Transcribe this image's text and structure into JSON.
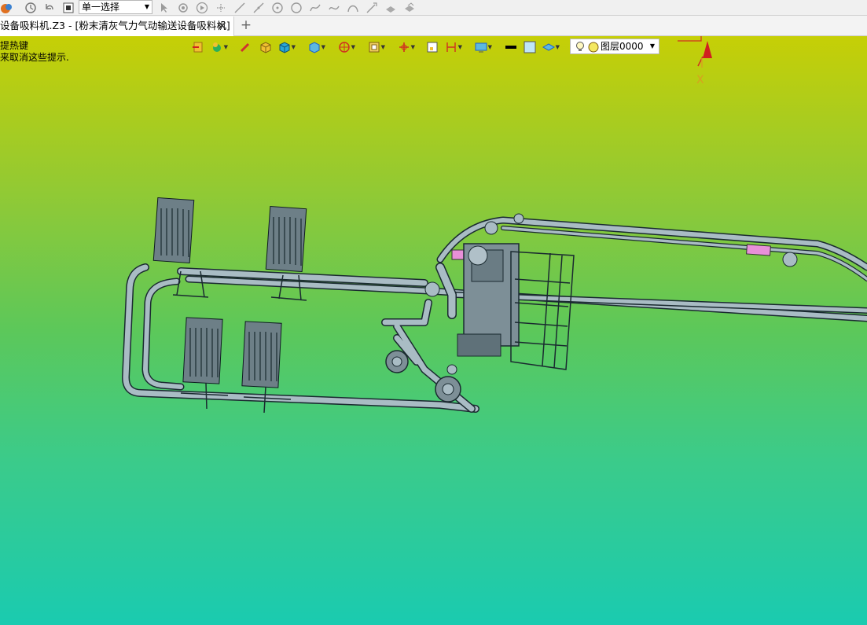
{
  "toolbar": {
    "filter_value": "单一选择",
    "icons": [
      "app-logo-icon",
      "history-icon",
      "undo-icon",
      "stop-icon",
      "cursor-icon",
      "snap-icon",
      "play-icon",
      "point-icon",
      "line-icon",
      "line-2-icon",
      "circle-icon",
      "circle-2-icon",
      "spline-icon",
      "curve-icon",
      "arc-icon",
      "extend-icon",
      "surface-icon",
      "surface-2-icon"
    ]
  },
  "tabs": {
    "document_title": "设备吸料机.Z3 - [粉末清灰气力气动输送设备吸料机]",
    "close_glyph": "✕",
    "add_glyph": "+"
  },
  "hint": {
    "line1": "提热键",
    "line2": "来取消这些提示."
  },
  "view_toolbar": {
    "layer_value": "图层0000",
    "colors": {
      "accent": "#1a5fd0",
      "gold": "#e0b020",
      "cyan": "#28a8d8",
      "red": "#d03020",
      "black": "#000000"
    }
  },
  "triad": {
    "x_label": "X"
  },
  "colors": {
    "bg_top": "#c6cf06",
    "bg_bottom": "#1acbb0",
    "pipe": "#a9bcc4",
    "pipe_edge": "#1a2a30",
    "accent_pink": "#e890d8"
  }
}
